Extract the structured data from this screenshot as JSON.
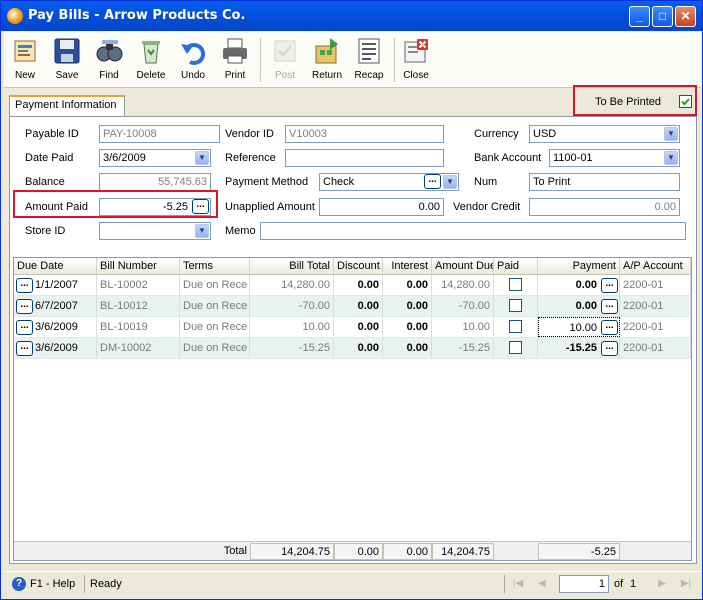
{
  "window": {
    "title": "Pay Bills - Arrow Products Co."
  },
  "toolbar": {
    "items": [
      {
        "label": "New",
        "icon": "new-icon",
        "enabled": true
      },
      {
        "label": "Save",
        "icon": "save-icon",
        "enabled": true
      },
      {
        "label": "Find",
        "icon": "find-icon",
        "enabled": true
      },
      {
        "label": "Delete",
        "icon": "delete-icon",
        "enabled": true
      },
      {
        "label": "Undo",
        "icon": "undo-icon",
        "enabled": true
      },
      {
        "label": "Print",
        "icon": "print-icon",
        "enabled": true
      },
      {
        "label": "Post",
        "icon": "post-icon",
        "enabled": false
      },
      {
        "label": "Return",
        "icon": "return-icon",
        "enabled": true
      },
      {
        "label": "Recap",
        "icon": "recap-icon",
        "enabled": true
      },
      {
        "label": "Close",
        "icon": "close-icon",
        "enabled": true
      }
    ]
  },
  "tab": {
    "label": "Payment Information"
  },
  "to_be_printed": {
    "label": "To Be Printed",
    "checked": true
  },
  "form": {
    "payable_id": {
      "label": "Payable ID",
      "value": "PAY-10008"
    },
    "vendor_id": {
      "label": "Vendor ID",
      "value": "V10003"
    },
    "currency": {
      "label": "Currency",
      "value": "USD"
    },
    "date_paid": {
      "label": "Date Paid",
      "value": "3/6/2009"
    },
    "reference": {
      "label": "Reference",
      "value": ""
    },
    "bank_account": {
      "label": "Bank Account",
      "value": "1100-01"
    },
    "balance": {
      "label": "Balance",
      "value": "55,745.63"
    },
    "payment_method": {
      "label": "Payment Method",
      "value": "Check"
    },
    "num": {
      "label": "Num",
      "value": "To Print"
    },
    "amount_paid": {
      "label": "Amount Paid",
      "value": "-5.25"
    },
    "unapplied_amount": {
      "label": "Unapplied Amount",
      "value": "0.00"
    },
    "vendor_credit": {
      "label": "Vendor Credit",
      "value": "0.00"
    },
    "store_id": {
      "label": "Store ID",
      "value": ""
    },
    "memo": {
      "label": "Memo",
      "value": ""
    }
  },
  "grid": {
    "columns": [
      "Due Date",
      "Bill Number",
      "Terms",
      "Bill Total",
      "Discount",
      "Interest",
      "Amount Due",
      "Paid",
      "Payment",
      "A/P Account"
    ],
    "rows": [
      {
        "due_date": "1/1/2007",
        "bill_number": "BL-10002",
        "terms": "Due on Rece",
        "bill_total": "14,280.00",
        "discount": "0.00",
        "interest": "0.00",
        "amount_due": "14,280.00",
        "paid": false,
        "payment": "0.00",
        "ap_account": "2200-01"
      },
      {
        "due_date": "6/7/2007",
        "bill_number": "BL-10012",
        "terms": "Due on Rece",
        "bill_total": "-70.00",
        "discount": "0.00",
        "interest": "0.00",
        "amount_due": "-70.00",
        "paid": false,
        "payment": "0.00",
        "ap_account": "2200-01"
      },
      {
        "due_date": "3/6/2009",
        "bill_number": "BL-10019",
        "terms": "Due on Rece",
        "bill_total": "10.00",
        "discount": "0.00",
        "interest": "0.00",
        "amount_due": "10.00",
        "paid": false,
        "payment": "10.00",
        "ap_account": "2200-01"
      },
      {
        "due_date": "3/6/2009",
        "bill_number": "DM-10002",
        "terms": "Due on Rece",
        "bill_total": "-15.25",
        "discount": "0.00",
        "interest": "0.00",
        "amount_due": "-15.25",
        "paid": false,
        "payment": "-15.25",
        "ap_account": "2200-01"
      }
    ],
    "totals": {
      "label": "Total",
      "bill_total": "14,204.75",
      "discount": "0.00",
      "interest": "0.00",
      "amount_due": "14,204.75",
      "payment": "-5.25"
    }
  },
  "status": {
    "help": "F1 - Help",
    "state": "Ready",
    "page": "1",
    "of_label": "of",
    "total_pages": "1"
  },
  "colors": {
    "title_bar": "#0450DD",
    "highlight_box": "#D8162B",
    "tab_accent": "#E6A33A"
  }
}
